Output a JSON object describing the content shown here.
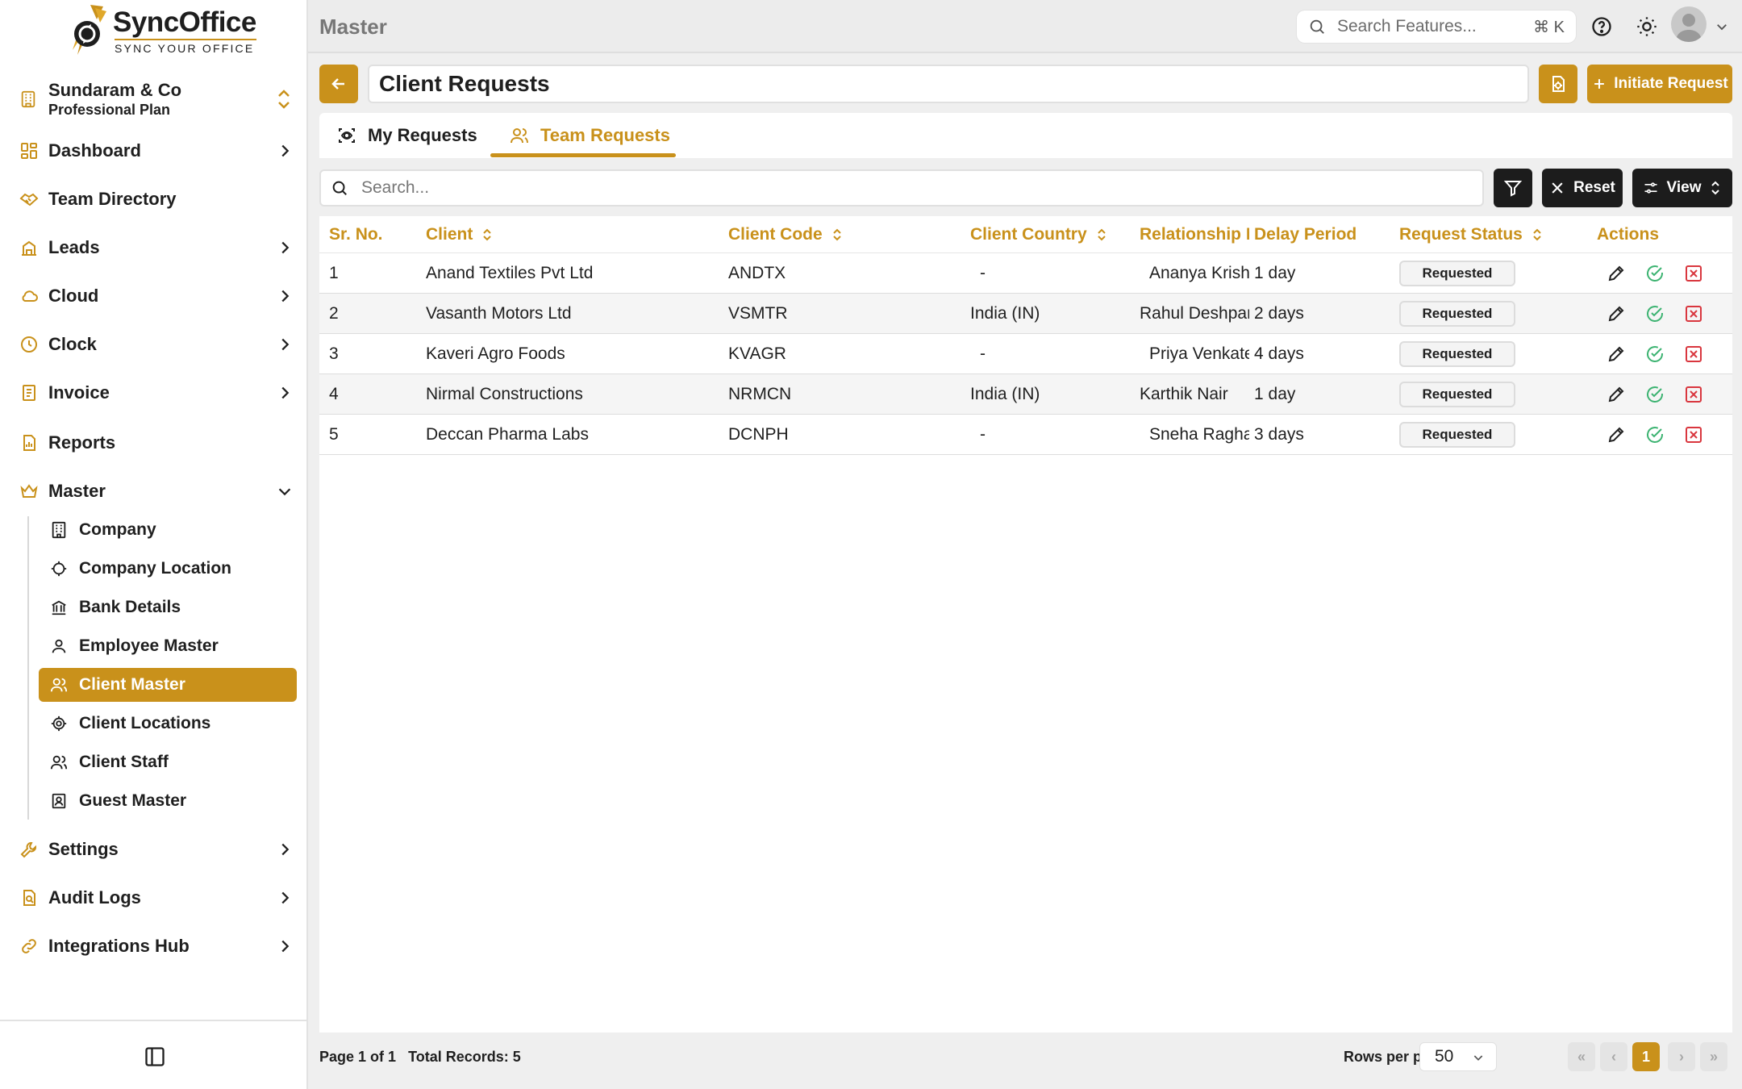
{
  "brand": {
    "name": "SyncOffice",
    "tagline": "SYNC YOUR OFFICE"
  },
  "org": {
    "name": "Sundaram & Co",
    "plan": "Professional Plan"
  },
  "nav": [
    {
      "label": "Dashboard",
      "icon": "dashboard-icon",
      "chevron": "right"
    },
    {
      "label": "Team Directory",
      "icon": "handshake-icon",
      "chevron": ""
    },
    {
      "label": "Leads",
      "icon": "leads-icon",
      "chevron": "right"
    },
    {
      "label": "Cloud",
      "icon": "cloud-icon",
      "chevron": "right"
    },
    {
      "label": "Clock",
      "icon": "clock-icon",
      "chevron": "right"
    },
    {
      "label": "Invoice",
      "icon": "invoice-icon",
      "chevron": "right"
    },
    {
      "label": "Reports",
      "icon": "reports-icon",
      "chevron": ""
    },
    {
      "label": "Master",
      "icon": "crown-icon",
      "chevron": "down"
    },
    {
      "label": "Settings",
      "icon": "wrench-icon",
      "chevron": "right"
    },
    {
      "label": "Audit Logs",
      "icon": "audit-icon",
      "chevron": "right"
    },
    {
      "label": "Integrations Hub",
      "icon": "link-icon",
      "chevron": "right"
    }
  ],
  "master_sub": [
    {
      "label": "Company",
      "icon": "building-icon",
      "active": false
    },
    {
      "label": "Company Location",
      "icon": "crosshair-icon",
      "active": false
    },
    {
      "label": "Bank Details",
      "icon": "bank-icon",
      "active": false
    },
    {
      "label": "Employee Master",
      "icon": "user-icon",
      "active": false
    },
    {
      "label": "Client Master",
      "icon": "users-icon",
      "active": true
    },
    {
      "label": "Client Locations",
      "icon": "location-target-icon",
      "active": false
    },
    {
      "label": "Client Staff",
      "icon": "users-icon",
      "active": false
    },
    {
      "label": "Guest Master",
      "icon": "contact-card-icon",
      "active": false
    }
  ],
  "topbar": {
    "breadcrumb": "Master",
    "search_placeholder": "Search Features...",
    "shortcut": "⌘ K"
  },
  "page": {
    "title": "Client Requests",
    "initiate_label": "Initiate Request"
  },
  "tabs": {
    "my": "My Requests",
    "team": "Team Requests",
    "active": "team"
  },
  "filters": {
    "search_placeholder": "Search...",
    "reset_label": "Reset",
    "view_label": "View"
  },
  "table": {
    "headers": {
      "sr": "Sr. No.",
      "client": "Client",
      "code": "Client Code",
      "country": "Client Country",
      "rm": "Relationship Manager",
      "delay": "Delay Period",
      "status": "Request Status",
      "actions": "Actions"
    },
    "rows": [
      {
        "sr": "1",
        "client": "Anand Textiles Pvt Ltd",
        "code": "ANDTX",
        "country": "-",
        "rm": "Ananya Krishnan",
        "delay": "1 day",
        "status": "Requested"
      },
      {
        "sr": "2",
        "client": "Vasanth Motors Ltd",
        "code": "VSMTR",
        "country": "India (IN)",
        "rm": "Rahul Deshpande",
        "delay": "2 days",
        "status": "Requested"
      },
      {
        "sr": "3",
        "client": "Kaveri Agro Foods",
        "code": "KVAGR",
        "country": "-",
        "rm": "Priya Venkatesh",
        "delay": "4 days",
        "status": "Requested"
      },
      {
        "sr": "4",
        "client": "Nirmal Constructions",
        "code": "NRMCN",
        "country": "India (IN)",
        "rm": "Karthik Nair",
        "delay": "1 day",
        "status": "Requested"
      },
      {
        "sr": "5",
        "client": "Deccan Pharma Labs",
        "code": "DCNPH",
        "country": "-",
        "rm": "Sneha Raghavan",
        "delay": "3 days",
        "status": "Requested"
      }
    ]
  },
  "footer": {
    "page_info": "Page 1 of 1",
    "total": "Total Records: 5",
    "rows_per_page_label": "Rows per page",
    "rows_per_page": "50",
    "current_page": "1"
  },
  "colors": {
    "accent": "#c9911b",
    "dark": "#1c1c1c",
    "success": "#3cb371",
    "danger": "#d9363e"
  }
}
